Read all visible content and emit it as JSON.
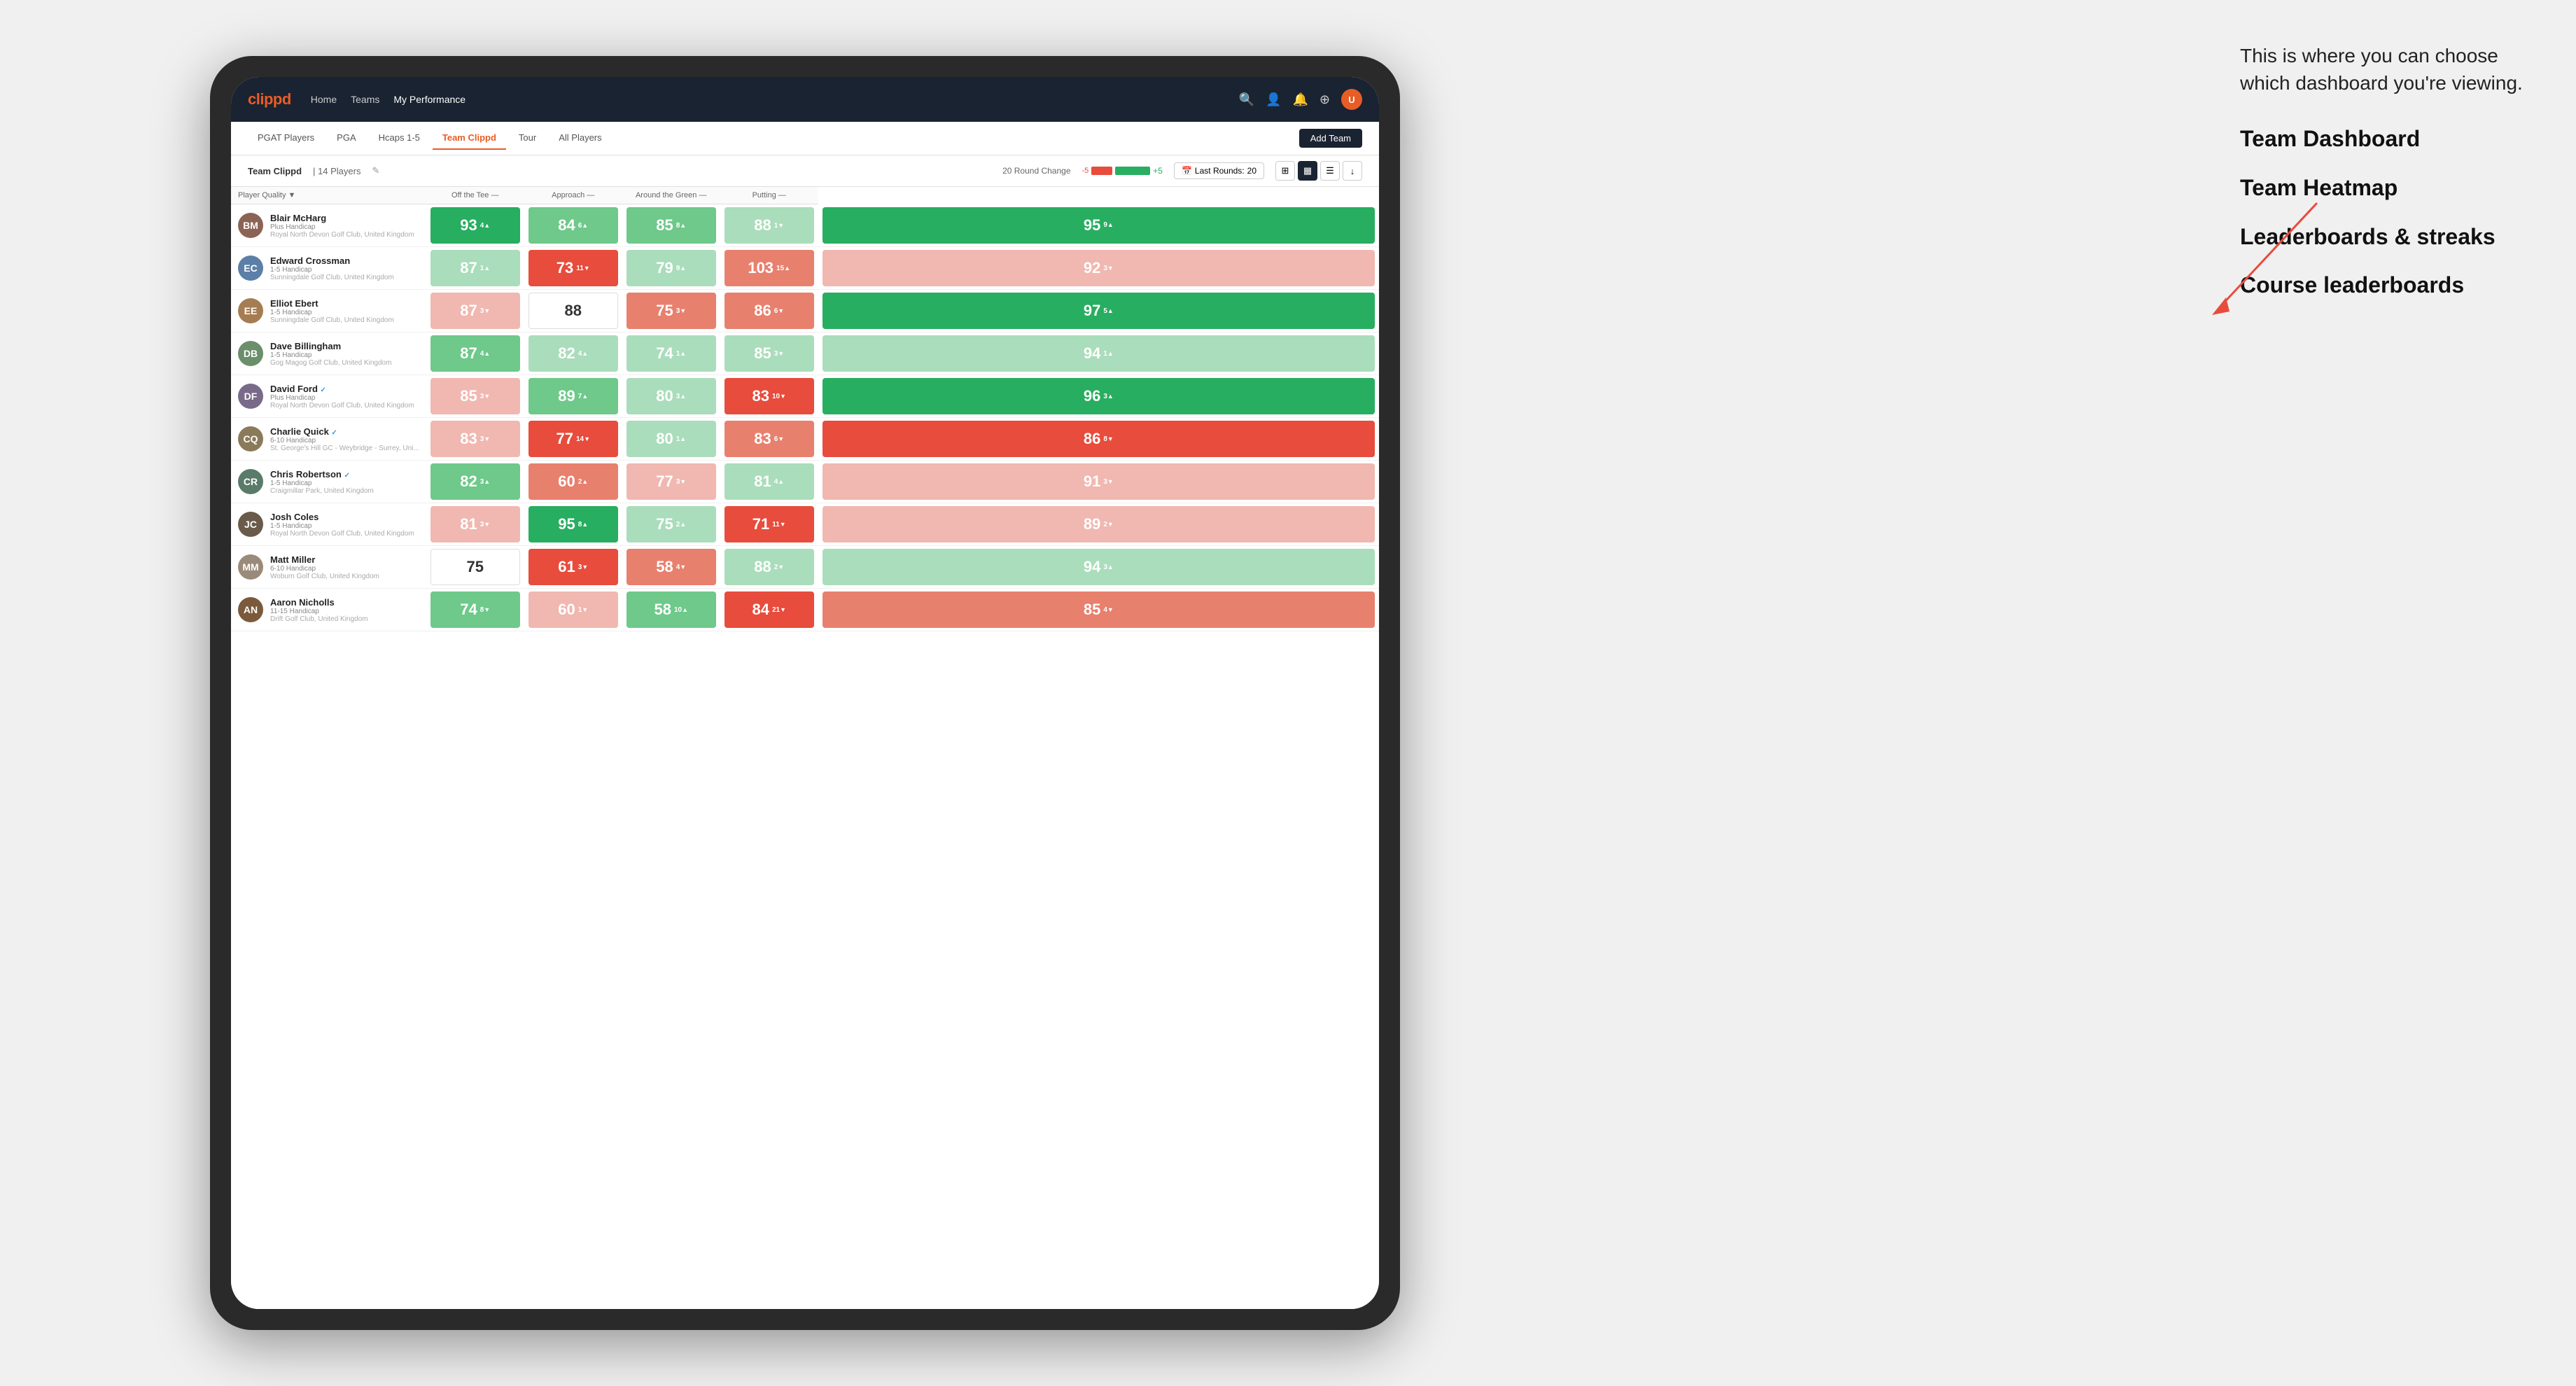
{
  "annotation": {
    "intro": "This is where you can choose which dashboard you're viewing.",
    "options": [
      "Team Dashboard",
      "Team Heatmap",
      "Leaderboards & streaks",
      "Course leaderboards"
    ]
  },
  "navbar": {
    "logo": "clippd",
    "links": [
      "Home",
      "Teams",
      "My Performance"
    ],
    "active_link": "My Performance"
  },
  "subnav": {
    "tabs": [
      "PGAT Players",
      "PGA",
      "Hcaps 1-5",
      "Team Clippd",
      "Tour",
      "All Players"
    ],
    "active_tab": "Team Clippd",
    "add_team_label": "Add Team"
  },
  "team_bar": {
    "name": "Team Clippd",
    "separator": "|",
    "count": "14 Players",
    "round_change_label": "20 Round Change",
    "bar_neg": "-5",
    "bar_pos": "+5",
    "last_rounds_label": "Last Rounds:",
    "last_rounds_value": "20"
  },
  "table": {
    "columns": {
      "player": "Player Quality ▼",
      "off_tee": "Off the Tee —",
      "approach": "Approach —",
      "around_green": "Around the Green —",
      "putting": "Putting —"
    },
    "players": [
      {
        "name": "Blair McHarg",
        "handicap": "Plus Handicap",
        "club": "Royal North Devon Golf Club, United Kingdom",
        "verified": false,
        "avatar_color": "#8B6355",
        "initials": "BM",
        "scores": {
          "player_quality": {
            "val": 93,
            "change": "4",
            "dir": "up",
            "color": "green-strong"
          },
          "off_tee": {
            "val": 84,
            "change": "6",
            "dir": "up",
            "color": "green-light"
          },
          "approach": {
            "val": 85,
            "change": "8",
            "dir": "up",
            "color": "green-light"
          },
          "around_green": {
            "val": 88,
            "change": "1",
            "dir": "down",
            "color": "green-pale"
          },
          "putting": {
            "val": 95,
            "change": "9",
            "dir": "up",
            "color": "green-strong"
          }
        }
      },
      {
        "name": "Edward Crossman",
        "handicap": "1-5 Handicap",
        "club": "Sunningdale Golf Club, United Kingdom",
        "verified": false,
        "avatar_color": "#5B7FA6",
        "initials": "EC",
        "scores": {
          "player_quality": {
            "val": 87,
            "change": "1",
            "dir": "up",
            "color": "green-pale"
          },
          "off_tee": {
            "val": 73,
            "change": "11",
            "dir": "down",
            "color": "red-strong"
          },
          "approach": {
            "val": 79,
            "change": "9",
            "dir": "up",
            "color": "green-pale"
          },
          "around_green": {
            "val": 103,
            "change": "15",
            "dir": "up",
            "color": "red-light"
          },
          "putting": {
            "val": 92,
            "change": "3",
            "dir": "down",
            "color": "red-pale"
          }
        }
      },
      {
        "name": "Elliot Ebert",
        "handicap": "1-5 Handicap",
        "club": "Sunningdale Golf Club, United Kingdom",
        "verified": false,
        "avatar_color": "#A67C52",
        "initials": "EE",
        "scores": {
          "player_quality": {
            "val": 87,
            "change": "3",
            "dir": "down",
            "color": "red-pale"
          },
          "off_tee": {
            "val": 88,
            "change": "",
            "dir": "none",
            "color": "white"
          },
          "approach": {
            "val": 75,
            "change": "3",
            "dir": "down",
            "color": "red-light"
          },
          "around_green": {
            "val": 86,
            "change": "6",
            "dir": "down",
            "color": "red-light"
          },
          "putting": {
            "val": 97,
            "change": "5",
            "dir": "up",
            "color": "green-strong"
          }
        }
      },
      {
        "name": "Dave Billingham",
        "handicap": "1-5 Handicap",
        "club": "Gog Magog Golf Club, United Kingdom",
        "verified": false,
        "avatar_color": "#6B8E6B",
        "initials": "DB",
        "scores": {
          "player_quality": {
            "val": 87,
            "change": "4",
            "dir": "up",
            "color": "green-light"
          },
          "off_tee": {
            "val": 82,
            "change": "4",
            "dir": "up",
            "color": "green-pale"
          },
          "approach": {
            "val": 74,
            "change": "1",
            "dir": "up",
            "color": "green-pale"
          },
          "around_green": {
            "val": 85,
            "change": "3",
            "dir": "down",
            "color": "green-pale"
          },
          "putting": {
            "val": 94,
            "change": "1",
            "dir": "up",
            "color": "green-pale"
          }
        }
      },
      {
        "name": "David Ford",
        "handicap": "Plus Handicap",
        "club": "Royal North Devon Golf Club, United Kingdom",
        "verified": true,
        "avatar_color": "#7A6A8A",
        "initials": "DF",
        "scores": {
          "player_quality": {
            "val": 85,
            "change": "3",
            "dir": "down",
            "color": "red-pale"
          },
          "off_tee": {
            "val": 89,
            "change": "7",
            "dir": "up",
            "color": "green-light"
          },
          "approach": {
            "val": 80,
            "change": "3",
            "dir": "up",
            "color": "green-pale"
          },
          "around_green": {
            "val": 83,
            "change": "10",
            "dir": "down",
            "color": "red-strong"
          },
          "putting": {
            "val": 96,
            "change": "3",
            "dir": "up",
            "color": "green-strong"
          }
        }
      },
      {
        "name": "Charlie Quick",
        "handicap": "6-10 Handicap",
        "club": "St. George's Hill GC - Weybridge - Surrey, Uni...",
        "verified": true,
        "avatar_color": "#8A7A5A",
        "initials": "CQ",
        "scores": {
          "player_quality": {
            "val": 83,
            "change": "3",
            "dir": "down",
            "color": "red-pale"
          },
          "off_tee": {
            "val": 77,
            "change": "14",
            "dir": "down",
            "color": "red-strong"
          },
          "approach": {
            "val": 80,
            "change": "1",
            "dir": "up",
            "color": "green-pale"
          },
          "around_green": {
            "val": 83,
            "change": "6",
            "dir": "down",
            "color": "red-light"
          },
          "putting": {
            "val": 86,
            "change": "8",
            "dir": "down",
            "color": "red-strong"
          }
        }
      },
      {
        "name": "Chris Robertson",
        "handicap": "1-5 Handicap",
        "club": "Craigmillar Park, United Kingdom",
        "verified": true,
        "avatar_color": "#5A7A6A",
        "initials": "CR",
        "scores": {
          "player_quality": {
            "val": 82,
            "change": "3",
            "dir": "up",
            "color": "green-light"
          },
          "off_tee": {
            "val": 60,
            "change": "2",
            "dir": "up",
            "color": "red-light"
          },
          "approach": {
            "val": 77,
            "change": "3",
            "dir": "down",
            "color": "red-pale"
          },
          "around_green": {
            "val": 81,
            "change": "4",
            "dir": "up",
            "color": "green-pale"
          },
          "putting": {
            "val": 91,
            "change": "3",
            "dir": "down",
            "color": "red-pale"
          }
        }
      },
      {
        "name": "Josh Coles",
        "handicap": "1-5 Handicap",
        "club": "Royal North Devon Golf Club, United Kingdom",
        "verified": false,
        "avatar_color": "#6A5A4A",
        "initials": "JC",
        "scores": {
          "player_quality": {
            "val": 81,
            "change": "3",
            "dir": "down",
            "color": "red-pale"
          },
          "off_tee": {
            "val": 95,
            "change": "8",
            "dir": "up",
            "color": "green-strong"
          },
          "approach": {
            "val": 75,
            "change": "2",
            "dir": "up",
            "color": "green-pale"
          },
          "around_green": {
            "val": 71,
            "change": "11",
            "dir": "down",
            "color": "red-strong"
          },
          "putting": {
            "val": 89,
            "change": "2",
            "dir": "down",
            "color": "red-pale"
          }
        }
      },
      {
        "name": "Matt Miller",
        "handicap": "6-10 Handicap",
        "club": "Woburn Golf Club, United Kingdom",
        "verified": false,
        "avatar_color": "#9A8A7A",
        "initials": "MM",
        "scores": {
          "player_quality": {
            "val": 75,
            "change": "",
            "dir": "none",
            "color": "white"
          },
          "off_tee": {
            "val": 61,
            "change": "3",
            "dir": "down",
            "color": "red-strong"
          },
          "approach": {
            "val": 58,
            "change": "4",
            "dir": "down",
            "color": "red-light"
          },
          "around_green": {
            "val": 88,
            "change": "2",
            "dir": "down",
            "color": "green-pale"
          },
          "putting": {
            "val": 94,
            "change": "3",
            "dir": "up",
            "color": "green-pale"
          }
        }
      },
      {
        "name": "Aaron Nicholls",
        "handicap": "11-15 Handicap",
        "club": "Drift Golf Club, United Kingdom",
        "verified": false,
        "avatar_color": "#7A5A3A",
        "initials": "AN",
        "scores": {
          "player_quality": {
            "val": 74,
            "change": "8",
            "dir": "down",
            "color": "green-light"
          },
          "off_tee": {
            "val": 60,
            "change": "1",
            "dir": "down",
            "color": "red-pale"
          },
          "approach": {
            "val": 58,
            "change": "10",
            "dir": "up",
            "color": "green-light"
          },
          "around_green": {
            "val": 84,
            "change": "21",
            "dir": "down",
            "color": "red-strong"
          },
          "putting": {
            "val": 85,
            "change": "4",
            "dir": "down",
            "color": "red-light"
          }
        }
      }
    ]
  }
}
